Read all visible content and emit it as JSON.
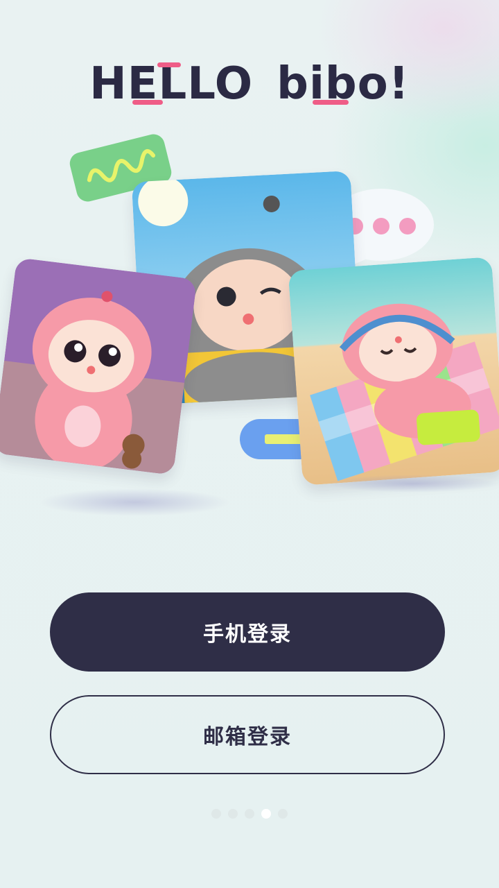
{
  "logo": {
    "word1": "HELLO",
    "word2": "bibo!"
  },
  "illustration": {
    "cards": [
      "pink-bibo-card",
      "gray-bibo-card",
      "beach-bibo-card"
    ],
    "decorations": [
      "green-wave-tag",
      "speech-bubble",
      "blue-pill-tag"
    ]
  },
  "buttons": {
    "phone_login": "手机登录",
    "email_login": "邮箱登录"
  },
  "pager": {
    "total": 5,
    "active_index": 3
  },
  "colors": {
    "primary": "#2f2e47",
    "accent_pink": "#ef5d87",
    "background": "#e6f1f1"
  }
}
